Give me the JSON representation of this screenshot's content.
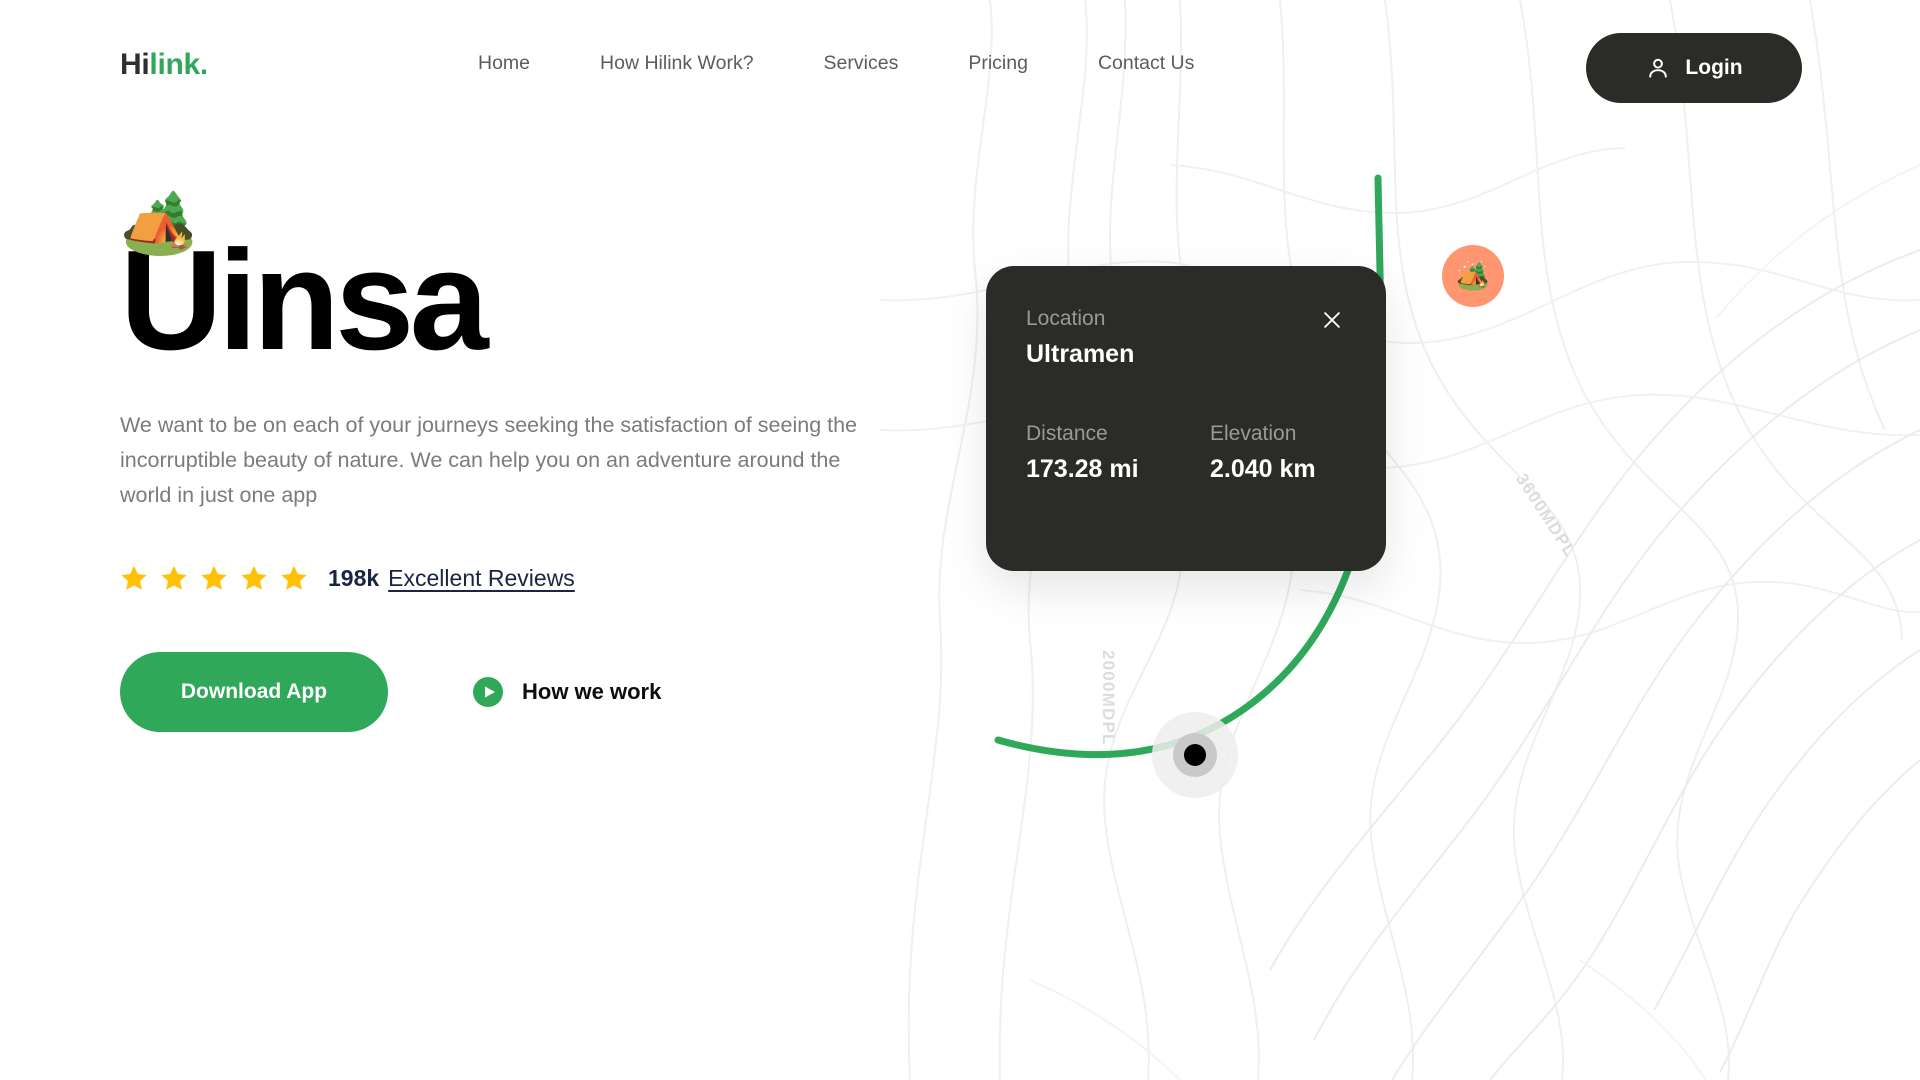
{
  "brand": {
    "name_part1": "Hi",
    "name_part2": "link.",
    "accent_color": "#30a85a",
    "dark_color": "#2b2b27"
  },
  "nav": {
    "items": [
      {
        "label": "Home"
      },
      {
        "label": "How Hilink Work?"
      },
      {
        "label": "Services"
      },
      {
        "label": "Pricing"
      },
      {
        "label": "Contact Us"
      }
    ],
    "login_label": "Login",
    "login_icon": "user-icon"
  },
  "hero": {
    "badge_emoji": "🏕️",
    "title": "Uinsa",
    "description": "We want to be on each of your journeys seeking the satisfaction of seeing the incorruptible beauty of nature. We can help you on an adventure around the world in just one app",
    "reviews": {
      "star_count": 5,
      "star_color": "#FFC107",
      "count": "198k",
      "link_label": "Excellent Reviews"
    },
    "primary_cta": "Download App",
    "secondary_cta": "How we work",
    "secondary_cta_icon": "play-circle-icon"
  },
  "map_card": {
    "location_label": "Location",
    "location_value": "Ultramen",
    "distance_label": "Distance",
    "distance_value": "173.28 mi",
    "elevation_label": "Elevation",
    "elevation_value": "2.040 km",
    "close_icon": "close-icon"
  },
  "map": {
    "elevation_labels": [
      {
        "text": "3600MDPL"
      },
      {
        "text": "2000MDPL"
      }
    ],
    "route_color": "#30a85a",
    "pin_color": "#ff9670",
    "pin_emoji": "🏕️",
    "start_point_color": "#000000"
  }
}
